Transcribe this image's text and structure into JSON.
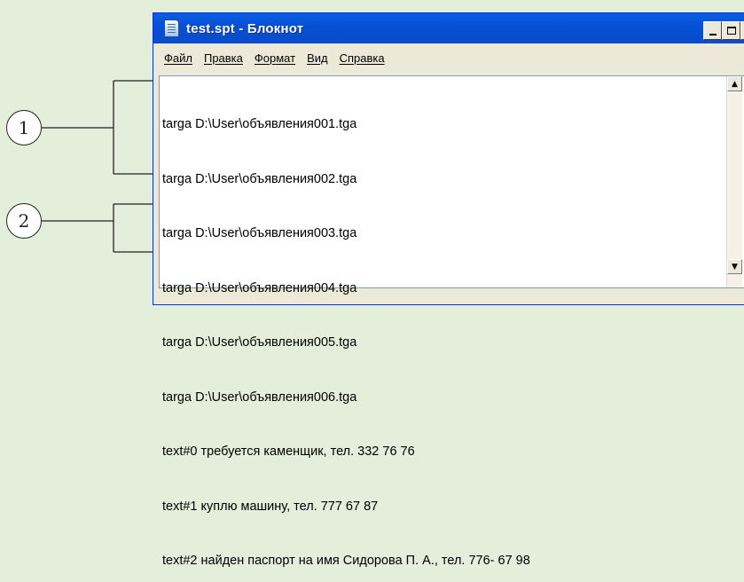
{
  "callouts": {
    "first": "1",
    "second": "2"
  },
  "window": {
    "title": "test.spt - Блокнот",
    "controls": {
      "minimize": "_",
      "maximize": "□",
      "close": "×"
    }
  },
  "menu": [
    {
      "label": "Файл"
    },
    {
      "label": "Правка"
    },
    {
      "label": "Формат"
    },
    {
      "label": "Вид"
    },
    {
      "label": "Справка"
    }
  ],
  "lines": [
    "targa D:\\User\\объявления001.tga",
    "targa D:\\User\\объявления002.tga",
    "targa D:\\User\\объявления003.tga",
    "targa D:\\User\\объявления004.tga",
    "targa D:\\User\\объявления005.tga",
    "targa D:\\User\\объявления006.tga",
    "text#0 требуется каменщик, тел. 332 76 76",
    "text#1 куплю машину, тел. 777 67 87",
    "text#2 найден паспорт на имя Сидорова П. А., тел. 776- 67 98"
  ],
  "scrollbar": {
    "up_icon": "arrow-up-icon",
    "down_icon": "arrow-down-icon"
  },
  "colors": {
    "titlebar": "#0a5fe3",
    "background": "#e3efdb",
    "editor": "#ffffff"
  }
}
